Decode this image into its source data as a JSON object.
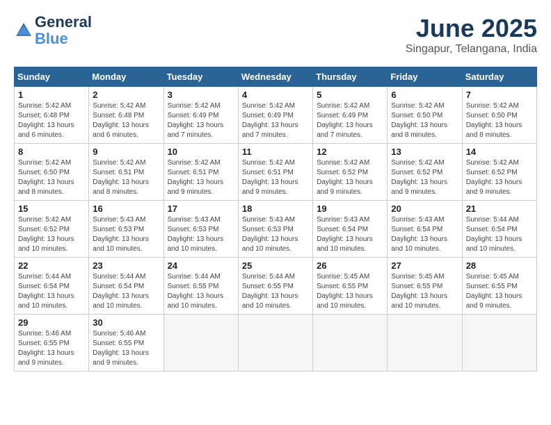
{
  "logo": {
    "line1": "General",
    "line2": "Blue"
  },
  "title": "June 2025",
  "subtitle": "Singapur, Telangana, India",
  "days_of_week": [
    "Sunday",
    "Monday",
    "Tuesday",
    "Wednesday",
    "Thursday",
    "Friday",
    "Saturday"
  ],
  "weeks": [
    [
      {
        "day": "1",
        "info": "Sunrise: 5:42 AM\nSunset: 6:48 PM\nDaylight: 13 hours\nand 6 minutes."
      },
      {
        "day": "2",
        "info": "Sunrise: 5:42 AM\nSunset: 6:48 PM\nDaylight: 13 hours\nand 6 minutes."
      },
      {
        "day": "3",
        "info": "Sunrise: 5:42 AM\nSunset: 6:49 PM\nDaylight: 13 hours\nand 7 minutes."
      },
      {
        "day": "4",
        "info": "Sunrise: 5:42 AM\nSunset: 6:49 PM\nDaylight: 13 hours\nand 7 minutes."
      },
      {
        "day": "5",
        "info": "Sunrise: 5:42 AM\nSunset: 6:49 PM\nDaylight: 13 hours\nand 7 minutes."
      },
      {
        "day": "6",
        "info": "Sunrise: 5:42 AM\nSunset: 6:50 PM\nDaylight: 13 hours\nand 8 minutes."
      },
      {
        "day": "7",
        "info": "Sunrise: 5:42 AM\nSunset: 6:50 PM\nDaylight: 13 hours\nand 8 minutes."
      }
    ],
    [
      {
        "day": "8",
        "info": "Sunrise: 5:42 AM\nSunset: 6:50 PM\nDaylight: 13 hours\nand 8 minutes."
      },
      {
        "day": "9",
        "info": "Sunrise: 5:42 AM\nSunset: 6:51 PM\nDaylight: 13 hours\nand 8 minutes."
      },
      {
        "day": "10",
        "info": "Sunrise: 5:42 AM\nSunset: 6:51 PM\nDaylight: 13 hours\nand 9 minutes."
      },
      {
        "day": "11",
        "info": "Sunrise: 5:42 AM\nSunset: 6:51 PM\nDaylight: 13 hours\nand 9 minutes."
      },
      {
        "day": "12",
        "info": "Sunrise: 5:42 AM\nSunset: 6:52 PM\nDaylight: 13 hours\nand 9 minutes."
      },
      {
        "day": "13",
        "info": "Sunrise: 5:42 AM\nSunset: 6:52 PM\nDaylight: 13 hours\nand 9 minutes."
      },
      {
        "day": "14",
        "info": "Sunrise: 5:42 AM\nSunset: 6:52 PM\nDaylight: 13 hours\nand 9 minutes."
      }
    ],
    [
      {
        "day": "15",
        "info": "Sunrise: 5:42 AM\nSunset: 6:52 PM\nDaylight: 13 hours\nand 10 minutes."
      },
      {
        "day": "16",
        "info": "Sunrise: 5:43 AM\nSunset: 6:53 PM\nDaylight: 13 hours\nand 10 minutes."
      },
      {
        "day": "17",
        "info": "Sunrise: 5:43 AM\nSunset: 6:53 PM\nDaylight: 13 hours\nand 10 minutes."
      },
      {
        "day": "18",
        "info": "Sunrise: 5:43 AM\nSunset: 6:53 PM\nDaylight: 13 hours\nand 10 minutes."
      },
      {
        "day": "19",
        "info": "Sunrise: 5:43 AM\nSunset: 6:54 PM\nDaylight: 13 hours\nand 10 minutes."
      },
      {
        "day": "20",
        "info": "Sunrise: 5:43 AM\nSunset: 6:54 PM\nDaylight: 13 hours\nand 10 minutes."
      },
      {
        "day": "21",
        "info": "Sunrise: 5:44 AM\nSunset: 6:54 PM\nDaylight: 13 hours\nand 10 minutes."
      }
    ],
    [
      {
        "day": "22",
        "info": "Sunrise: 5:44 AM\nSunset: 6:54 PM\nDaylight: 13 hours\nand 10 minutes."
      },
      {
        "day": "23",
        "info": "Sunrise: 5:44 AM\nSunset: 6:54 PM\nDaylight: 13 hours\nand 10 minutes."
      },
      {
        "day": "24",
        "info": "Sunrise: 5:44 AM\nSunset: 6:55 PM\nDaylight: 13 hours\nand 10 minutes."
      },
      {
        "day": "25",
        "info": "Sunrise: 5:44 AM\nSunset: 6:55 PM\nDaylight: 13 hours\nand 10 minutes."
      },
      {
        "day": "26",
        "info": "Sunrise: 5:45 AM\nSunset: 6:55 PM\nDaylight: 13 hours\nand 10 minutes."
      },
      {
        "day": "27",
        "info": "Sunrise: 5:45 AM\nSunset: 6:55 PM\nDaylight: 13 hours\nand 10 minutes."
      },
      {
        "day": "28",
        "info": "Sunrise: 5:45 AM\nSunset: 6:55 PM\nDaylight: 13 hours\nand 9 minutes."
      }
    ],
    [
      {
        "day": "29",
        "info": "Sunrise: 5:46 AM\nSunset: 6:55 PM\nDaylight: 13 hours\nand 9 minutes."
      },
      {
        "day": "30",
        "info": "Sunrise: 5:46 AM\nSunset: 6:55 PM\nDaylight: 13 hours\nand 9 minutes."
      },
      {
        "day": "",
        "info": ""
      },
      {
        "day": "",
        "info": ""
      },
      {
        "day": "",
        "info": ""
      },
      {
        "day": "",
        "info": ""
      },
      {
        "day": "",
        "info": ""
      }
    ]
  ]
}
